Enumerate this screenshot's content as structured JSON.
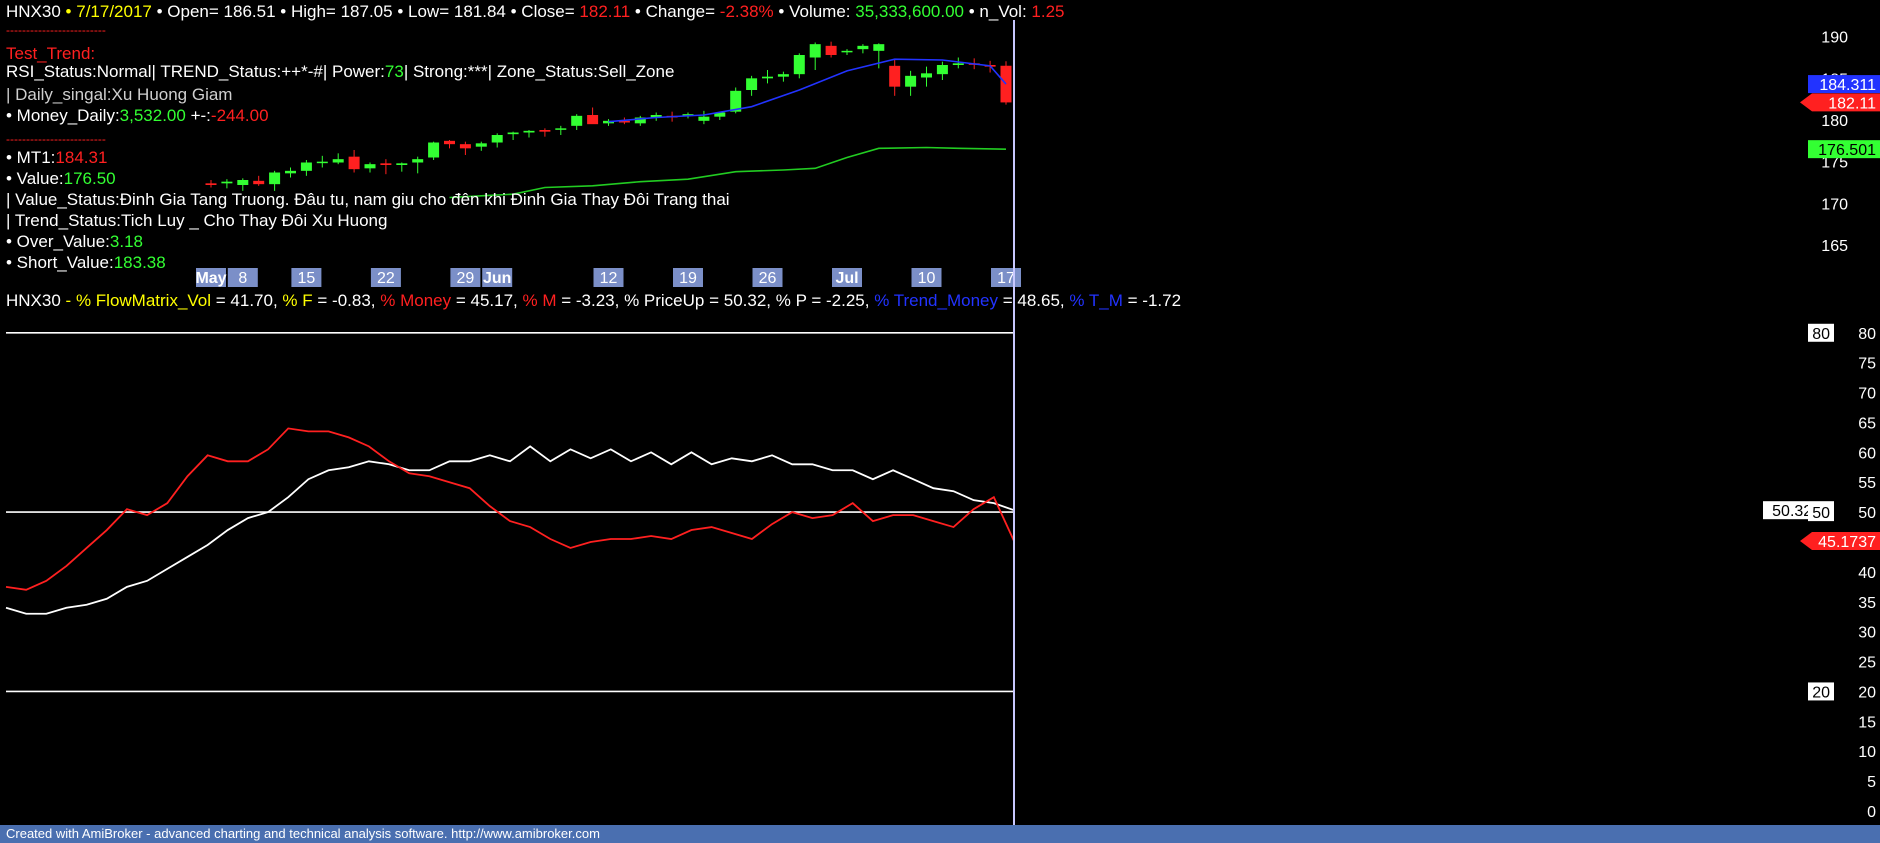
{
  "colors": {
    "green": "#33ff33",
    "red": "#ff2020",
    "white": "#ffffff",
    "yellow": "#ffff00",
    "blue": "#2233ff",
    "mt1": "#2233ff",
    "value_line": "#22cc22",
    "date_bg": "#7b8fc8",
    "cursor": "#c8c8ff"
  },
  "header": {
    "symbol": "HNX30",
    "date": "7/17/2017",
    "open_label": "Open=",
    "open": "186.51",
    "high_label": "High=",
    "high": "187.05",
    "low_label": "Low=",
    "low": "181.84",
    "close_label": "Close=",
    "close": "182.11",
    "change_label": "Change=",
    "change": "-2.38%",
    "volume_label": "Volume:",
    "volume": "35,333,600.00",
    "nvol_label": "n_Vol:",
    "nvol": "1.25",
    "sep": "•"
  },
  "info": {
    "dashes": "-------------------------",
    "test_trend": "Test_Trend:",
    "rsi_line": "RSI_Status:Normal| TREND_Status:++*-#| Power:",
    "power": "73",
    "rsi_line_tail": "| Strong:***| Zone_Status:Sell_Zone",
    "daily_signal": "| Daily_singal:Xu Huong Giam",
    "money_label": "• Money_Daily:",
    "money": "3,532.00",
    "money_sep": " +-:",
    "money_change": "-244.00",
    "mt1_label": "• MT1:",
    "mt1": "184.31",
    "value_label": "• Value:",
    "value": "176.50",
    "value_status": "| Value_Status:Đinh Gia Tang Truong. Đâu tu, nam giu cho đên khi Đinh Gia Thay Đôi Trang thai",
    "trend_status": "| Trend_Status:Tich Luy _ Cho Thay Đôi Xu Huong",
    "over_label": "• Over_Value:",
    "over": "3.18",
    "short_label": "• Short_Value:",
    "short": "183.38"
  },
  "indicator_header": {
    "symbol": "HNX30",
    "flow_label": "% FlowMatrix_Vol",
    "flow": "41.70",
    "f_label": "% F",
    "f": "-0.83",
    "money_label": "% Money",
    "money": "45.17",
    "m_label": "% M",
    "m": "-3.23",
    "priceup_label": "% PriceUp",
    "priceup": "50.32",
    "p_label": "% P",
    "p": "-2.25",
    "trend_money_label": "% Trend_Money",
    "trend_money": "48.65",
    "tm_label": "% T_M",
    "tm": "-1.72"
  },
  "footer": "Created with AmiBroker - advanced charting and technical analysis software. http://www.amibroker.com",
  "chart_data": [
    {
      "type": "candlestick",
      "ylim": [
        162,
        192
      ],
      "yticks": [
        165,
        170,
        175,
        180,
        185,
        190
      ],
      "date_labels": [
        {
          "i": 0,
          "label": "May"
        },
        {
          "i": 2,
          "label": "8"
        },
        {
          "i": 6,
          "label": "15"
        },
        {
          "i": 11,
          "label": "22"
        },
        {
          "i": 16,
          "label": "29"
        },
        {
          "i": 18,
          "label": "Jun"
        },
        {
          "i": 25,
          "label": "12"
        },
        {
          "i": 30,
          "label": "19"
        },
        {
          "i": 35,
          "label": "26"
        },
        {
          "i": 40,
          "label": "Jul"
        },
        {
          "i": 45,
          "label": "10"
        },
        {
          "i": 50,
          "label": "17"
        }
      ],
      "ohlc": [
        [
          172.4,
          172.8,
          171.9,
          172.2
        ],
        [
          172.4,
          172.9,
          171.8,
          172.6
        ],
        [
          172.2,
          173.0,
          171.5,
          172.8
        ],
        [
          172.7,
          173.3,
          172.1,
          172.3
        ],
        [
          172.3,
          173.9,
          171.5,
          173.7
        ],
        [
          173.6,
          174.3,
          173.1,
          173.9
        ],
        [
          173.9,
          175.2,
          173.3,
          174.9
        ],
        [
          174.9,
          175.7,
          174.3,
          175.0
        ],
        [
          174.9,
          176.0,
          174.7,
          175.3
        ],
        [
          175.6,
          176.4,
          173.7,
          174.1
        ],
        [
          174.2,
          174.9,
          173.7,
          174.7
        ],
        [
          174.8,
          175.3,
          173.5,
          174.6
        ],
        [
          174.6,
          174.9,
          173.8,
          174.8
        ],
        [
          174.9,
          175.6,
          173.6,
          175.3
        ],
        [
          175.5,
          177.4,
          175.2,
          177.3
        ],
        [
          177.5,
          177.6,
          176.6,
          177.1
        ],
        [
          177.1,
          177.4,
          175.8,
          176.6
        ],
        [
          176.8,
          177.4,
          176.3,
          177.2
        ],
        [
          177.3,
          178.4,
          176.7,
          178.2
        ],
        [
          178.3,
          178.6,
          177.6,
          178.5
        ],
        [
          178.5,
          178.8,
          177.9,
          178.7
        ],
        [
          178.8,
          179.0,
          178.0,
          178.6
        ],
        [
          178.9,
          179.3,
          178.2,
          179.0
        ],
        [
          179.3,
          180.7,
          178.8,
          180.5
        ],
        [
          180.6,
          181.5,
          179.7,
          179.5
        ],
        [
          179.6,
          180.1,
          179.3,
          179.9
        ],
        [
          179.9,
          180.3,
          179.5,
          179.7
        ],
        [
          179.6,
          180.5,
          179.3,
          180.3
        ],
        [
          180.3,
          180.9,
          179.9,
          180.6
        ],
        [
          180.5,
          181.0,
          179.8,
          180.3
        ],
        [
          180.5,
          180.9,
          180.2,
          180.7
        ],
        [
          179.9,
          181.1,
          179.5,
          180.4
        ],
        [
          180.4,
          181.0,
          180.0,
          180.9
        ],
        [
          181.0,
          183.9,
          180.8,
          183.5
        ],
        [
          183.6,
          185.3,
          182.9,
          185.0
        ],
        [
          185.0,
          186.0,
          184.4,
          185.2
        ],
        [
          185.2,
          185.8,
          184.6,
          185.5
        ],
        [
          185.5,
          188.0,
          185.0,
          187.8
        ],
        [
          187.5,
          189.3,
          186.0,
          189.1
        ],
        [
          188.9,
          189.4,
          187.5,
          187.8
        ],
        [
          188.2,
          188.5,
          187.8,
          188.3
        ],
        [
          188.5,
          189.1,
          188.0,
          188.9
        ],
        [
          188.3,
          189.2,
          186.2,
          189.1
        ],
        [
          186.5,
          187.3,
          182.9,
          184.0
        ],
        [
          184.0,
          185.9,
          182.9,
          185.3
        ],
        [
          185.1,
          186.4,
          184.0,
          185.6
        ],
        [
          185.5,
          187.0,
          184.8,
          186.6
        ],
        [
          186.6,
          187.5,
          186.2,
          186.8
        ],
        [
          186.8,
          187.4,
          186.1,
          186.7
        ],
        [
          186.6,
          187.1,
          185.7,
          186.4
        ],
        [
          186.51,
          187.05,
          181.84,
          182.11
        ]
      ],
      "mt1_line": [
        {
          "i": 25,
          "v": 179.8
        },
        {
          "i": 28,
          "v": 180.3
        },
        {
          "i": 31,
          "v": 180.6
        },
        {
          "i": 34,
          "v": 181.6
        },
        {
          "i": 37,
          "v": 183.6
        },
        {
          "i": 40,
          "v": 185.9
        },
        {
          "i": 43,
          "v": 187.3
        },
        {
          "i": 46,
          "v": 187.2
        },
        {
          "i": 49,
          "v": 186.5
        },
        {
          "i": 50,
          "v": 184.31
        }
      ],
      "value_line": [
        {
          "i": 15,
          "v": 170.7
        },
        {
          "i": 17,
          "v": 170.9
        },
        {
          "i": 19,
          "v": 171.1
        },
        {
          "i": 21,
          "v": 171.9
        },
        {
          "i": 24,
          "v": 172.1
        },
        {
          "i": 27,
          "v": 172.6
        },
        {
          "i": 30,
          "v": 172.9
        },
        {
          "i": 33,
          "v": 173.8
        },
        {
          "i": 36,
          "v": 174.0
        },
        {
          "i": 38,
          "v": 174.2
        },
        {
          "i": 40,
          "v": 175.5
        },
        {
          "i": 42,
          "v": 176.6
        },
        {
          "i": 45,
          "v": 176.7
        },
        {
          "i": 47,
          "v": 176.6
        },
        {
          "i": 50,
          "v": 176.5
        }
      ],
      "price_tags": [
        {
          "label": "184.311",
          "v": 184.311,
          "color": "blue"
        },
        {
          "label": "182.11",
          "v": 182.11,
          "color": "red"
        },
        {
          "label": "176.501",
          "v": 176.501,
          "color": "green"
        }
      ]
    },
    {
      "type": "line",
      "ylim": [
        0,
        90
      ],
      "yticks": [
        0,
        5,
        10,
        15,
        20,
        25,
        30,
        35,
        40,
        45,
        50,
        55,
        60,
        65,
        70,
        75,
        80
      ],
      "hlines": [
        20,
        50,
        80
      ],
      "series": [
        {
          "name": "% PriceUp",
          "color": "white",
          "values": [
            {
              "i": 0,
              "v": 34.0
            },
            {
              "i": 1,
              "v": 33.0
            },
            {
              "i": 2,
              "v": 33.0
            },
            {
              "i": 3,
              "v": 34.0
            },
            {
              "i": 4,
              "v": 34.5
            },
            {
              "i": 5,
              "v": 35.5
            },
            {
              "i": 6,
              "v": 37.5
            },
            {
              "i": 7,
              "v": 38.5
            },
            {
              "i": 8,
              "v": 40.5
            },
            {
              "i": 9,
              "v": 42.5
            },
            {
              "i": 10,
              "v": 44.5
            },
            {
              "i": 11,
              "v": 47.0
            },
            {
              "i": 12,
              "v": 49.0
            },
            {
              "i": 13,
              "v": 50.0
            },
            {
              "i": 14,
              "v": 52.5
            },
            {
              "i": 15,
              "v": 55.5
            },
            {
              "i": 16,
              "v": 57.0
            },
            {
              "i": 17,
              "v": 57.5
            },
            {
              "i": 18,
              "v": 58.5
            },
            {
              "i": 19,
              "v": 58.0
            },
            {
              "i": 20,
              "v": 57.0
            },
            {
              "i": 21,
              "v": 57.0
            },
            {
              "i": 22,
              "v": 58.5
            },
            {
              "i": 23,
              "v": 58.5
            },
            {
              "i": 24,
              "v": 59.5
            },
            {
              "i": 25,
              "v": 58.5
            },
            {
              "i": 26,
              "v": 61.0
            },
            {
              "i": 27,
              "v": 58.5
            },
            {
              "i": 28,
              "v": 60.5
            },
            {
              "i": 29,
              "v": 59.0
            },
            {
              "i": 30,
              "v": 60.5
            },
            {
              "i": 31,
              "v": 58.5
            },
            {
              "i": 32,
              "v": 60.0
            },
            {
              "i": 33,
              "v": 58.0
            },
            {
              "i": 34,
              "v": 60.0
            },
            {
              "i": 35,
              "v": 58.0
            },
            {
              "i": 36,
              "v": 59.0
            },
            {
              "i": 37,
              "v": 58.5
            },
            {
              "i": 38,
              "v": 59.5
            },
            {
              "i": 39,
              "v": 58.0
            },
            {
              "i": 40,
              "v": 58.0
            },
            {
              "i": 41,
              "v": 57.0
            },
            {
              "i": 42,
              "v": 57.0
            },
            {
              "i": 43,
              "v": 55.5
            },
            {
              "i": 44,
              "v": 57.0
            },
            {
              "i": 45,
              "v": 55.5
            },
            {
              "i": 46,
              "v": 54.0
            },
            {
              "i": 47,
              "v": 53.5
            },
            {
              "i": 48,
              "v": 52.0
            },
            {
              "i": 49,
              "v": 51.5
            },
            {
              "i": 50,
              "v": 50.32
            }
          ]
        },
        {
          "name": "% Money",
          "color": "red",
          "values": [
            {
              "i": 0,
              "v": 37.5
            },
            {
              "i": 1,
              "v": 37.0
            },
            {
              "i": 2,
              "v": 38.5
            },
            {
              "i": 3,
              "v": 41.0
            },
            {
              "i": 4,
              "v": 44.0
            },
            {
              "i": 5,
              "v": 47.0
            },
            {
              "i": 6,
              "v": 50.5
            },
            {
              "i": 7,
              "v": 49.5
            },
            {
              "i": 8,
              "v": 51.5
            },
            {
              "i": 9,
              "v": 56.0
            },
            {
              "i": 10,
              "v": 59.5
            },
            {
              "i": 11,
              "v": 58.5
            },
            {
              "i": 12,
              "v": 58.5
            },
            {
              "i": 13,
              "v": 60.5
            },
            {
              "i": 14,
              "v": 64.0
            },
            {
              "i": 15,
              "v": 63.5
            },
            {
              "i": 16,
              "v": 63.5
            },
            {
              "i": 17,
              "v": 62.5
            },
            {
              "i": 18,
              "v": 61.0
            },
            {
              "i": 19,
              "v": 58.5
            },
            {
              "i": 20,
              "v": 56.5
            },
            {
              "i": 21,
              "v": 56.0
            },
            {
              "i": 22,
              "v": 55.0
            },
            {
              "i": 23,
              "v": 54.0
            },
            {
              "i": 24,
              "v": 51.0
            },
            {
              "i": 25,
              "v": 48.5
            },
            {
              "i": 26,
              "v": 47.5
            },
            {
              "i": 27,
              "v": 45.5
            },
            {
              "i": 28,
              "v": 44.0
            },
            {
              "i": 29,
              "v": 45.0
            },
            {
              "i": 30,
              "v": 45.5
            },
            {
              "i": 31,
              "v": 45.5
            },
            {
              "i": 32,
              "v": 46.0
            },
            {
              "i": 33,
              "v": 45.5
            },
            {
              "i": 34,
              "v": 47.0
            },
            {
              "i": 35,
              "v": 47.5
            },
            {
              "i": 36,
              "v": 46.5
            },
            {
              "i": 37,
              "v": 45.5
            },
            {
              "i": 38,
              "v": 48.0
            },
            {
              "i": 39,
              "v": 50.0
            },
            {
              "i": 40,
              "v": 49.0
            },
            {
              "i": 41,
              "v": 49.5
            },
            {
              "i": 42,
              "v": 51.5
            },
            {
              "i": 43,
              "v": 48.5
            },
            {
              "i": 44,
              "v": 49.5
            },
            {
              "i": 45,
              "v": 49.5
            },
            {
              "i": 46,
              "v": 48.5
            },
            {
              "i": 47,
              "v": 47.5
            },
            {
              "i": 48,
              "v": 50.5
            },
            {
              "i": 49,
              "v": 52.5
            },
            {
              "i": 50,
              "v": 45.17
            }
          ]
        }
      ],
      "value_tags": [
        {
          "label": "80",
          "v": 80,
          "color": "white"
        },
        {
          "label": "50.3218",
          "v": 50.3218,
          "color": "white"
        },
        {
          "label": "50",
          "v": 50,
          "color": "white"
        },
        {
          "label": "45.1737",
          "v": 45.1737,
          "color": "red"
        },
        {
          "label": "20",
          "v": 20,
          "color": "white"
        }
      ]
    }
  ]
}
